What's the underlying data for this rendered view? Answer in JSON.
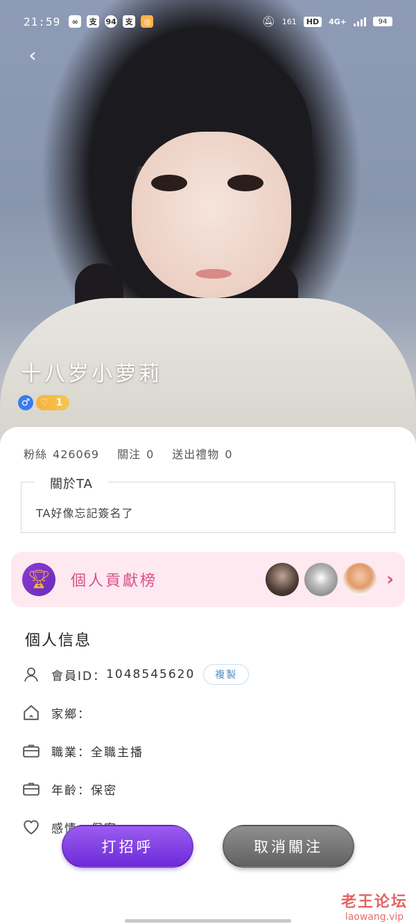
{
  "status_bar": {
    "time": "21:59",
    "app_icons": [
      "支",
      "94",
      "支"
    ],
    "net_speed": "161",
    "hd": "HD",
    "network": "4G+",
    "battery": "94"
  },
  "profile": {
    "name": "十八岁小萝莉",
    "level": "1",
    "gender_icon": "male-icon"
  },
  "stats": {
    "fans_label": "粉絲",
    "fans_value": "426069",
    "follow_label": "關注",
    "follow_value": "0",
    "gifts_label": "送出禮物",
    "gifts_value": "0"
  },
  "about": {
    "title": "關於TA",
    "text": "TA好像忘記簽名了"
  },
  "contribution": {
    "label": "個人貢獻榜"
  },
  "info": {
    "section_title": "個人信息",
    "member_id_label": "會員ID：",
    "member_id_value": "1048545620",
    "copy_label": "複製",
    "hometown_label": "家鄉：",
    "hometown_value": "",
    "job_label": "職業：",
    "job_value": "全職主播",
    "age_label": "年齡：",
    "age_value": "保密",
    "relationship_label": "感情：",
    "relationship_value": "保密"
  },
  "actions": {
    "greet_label": "打招呼",
    "unfollow_label": "取消關注"
  },
  "watermark": {
    "line1": "老王论坛",
    "line2": "laowang.vip"
  },
  "colors": {
    "accent_pink": "#d9508a",
    "greet_purple": "#7b35e0",
    "unfollow_gray": "#707070"
  }
}
